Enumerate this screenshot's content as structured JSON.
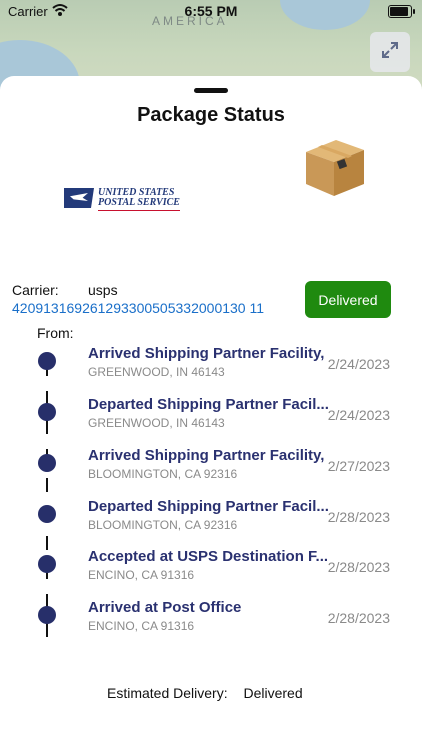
{
  "status_bar": {
    "carrier": "Carrier",
    "time": "6:55 PM",
    "battery_level_percent": 100
  },
  "map": {
    "label": "AMERICA"
  },
  "sheet": {
    "title": "Package Status",
    "carrier_label": "Carrier:",
    "carrier_value": "usps",
    "tracking_number": "420913169261293300505332000130 11",
    "status_badge": "Delivered",
    "from_label": "From:",
    "usps_logo_text": [
      "UNITED STATES",
      "POSTAL SERVICE"
    ],
    "events": [
      {
        "status": "Arrived Shipping Partner Facility,",
        "location": "GREENWOOD, IN 46143",
        "date": "2/24/2023"
      },
      {
        "status": "Departed Shipping Partner Facil...",
        "location": "GREENWOOD, IN 46143",
        "date": "2/24/2023"
      },
      {
        "status": "Arrived Shipping Partner Facility,",
        "location": "BLOOMINGTON, CA 92316",
        "date": "2/27/2023"
      },
      {
        "status": "Departed Shipping Partner Facil...",
        "location": "BLOOMINGTON, CA 92316",
        "date": "2/28/2023"
      },
      {
        "status": "Accepted at USPS Destination F...",
        "location": "ENCINO, CA 91316",
        "date": "2/28/2023"
      },
      {
        "status": "Arrived at Post Office",
        "location": "ENCINO, CA 91316",
        "date": "2/28/2023"
      }
    ],
    "estimated_delivery_label": "Estimated Delivery:",
    "estimated_delivery_value": "Delivered"
  },
  "colors": {
    "accent_link": "#1a6fc9",
    "delivered_green": "#1f8a0f",
    "timeline_navy": "#272f6a"
  },
  "icons": [
    "wifi-icon",
    "battery-icon",
    "expand-icon",
    "usps-eagle-logo",
    "package-box-icon"
  ]
}
